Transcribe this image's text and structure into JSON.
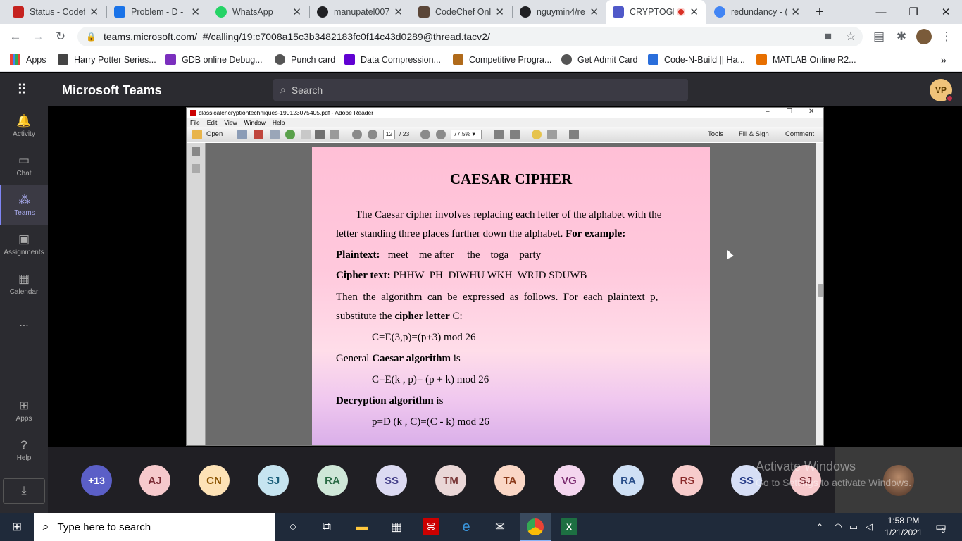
{
  "browser": {
    "tabs": [
      {
        "title": "Status - Codef",
        "color": "#c5221f"
      },
      {
        "title": "Problem - D -",
        "color": "#1a73e8"
      },
      {
        "title": "WhatsApp",
        "color": "#25d366"
      },
      {
        "title": "manupatel007",
        "color": "#202124"
      },
      {
        "title": "CodeChef Onli",
        "color": "#5b4638"
      },
      {
        "title": "nguymin4/reac",
        "color": "#202124"
      },
      {
        "title": "CRYPTOGI",
        "color": "#5059c9"
      },
      {
        "title": "redundancy - (",
        "color": "#4285f4"
      }
    ],
    "url": "teams.microsoft.com/_#/calling/19:c7008a15c3b3482183fc0f14c43d0289@thread.tacv2/",
    "bookmarks": [
      {
        "label": "Apps",
        "color": "#4285f4"
      },
      {
        "label": "Harry Potter Series...",
        "color": "#444"
      },
      {
        "label": "GDB online Debug...",
        "color": "#7b2fbe"
      },
      {
        "label": "Punch card",
        "color": "#555"
      },
      {
        "label": "Data Compression...",
        "color": "#6001d2"
      },
      {
        "label": "Competitive Progra...",
        "color": "#b06a1a"
      },
      {
        "label": "Get Admit Card",
        "color": "#555"
      },
      {
        "label": "Code-N-Build || Ha...",
        "color": "#2a6edb"
      },
      {
        "label": "MATLAB Online R2...",
        "color": "#e76f00"
      }
    ]
  },
  "teams": {
    "app_name": "Microsoft Teams",
    "search_placeholder": "Search",
    "user_initials": "VP",
    "rail": [
      {
        "label": "Activity",
        "icon": "bell-icon"
      },
      {
        "label": "Chat",
        "icon": "chat-icon"
      },
      {
        "label": "Teams",
        "icon": "teams-icon"
      },
      {
        "label": "Assignments",
        "icon": "assignments-icon"
      },
      {
        "label": "Calendar",
        "icon": "calendar-icon"
      },
      {
        "label": "...",
        "icon": "more-icon"
      },
      {
        "label": "Apps",
        "icon": "apps-icon"
      },
      {
        "label": "Help",
        "icon": "help-icon"
      }
    ],
    "participants": [
      "+13",
      "AJ",
      "CN",
      "SJ",
      "RA",
      "SS",
      "TM",
      "TA",
      "VG",
      "RA",
      "RS",
      "SS",
      "SJ"
    ],
    "activate_title": "Activate Windows",
    "activate_sub": "Go to Settings to activate Windows."
  },
  "reader": {
    "title": "classicalencryptiontechniques-190123075405.pdf - Adobe Reader",
    "menu": [
      "File",
      "Edit",
      "View",
      "Window",
      "Help"
    ],
    "open_label": "Open",
    "page_current": "12",
    "page_total": "/ 23",
    "zoom": "77.5%",
    "tools_label": "Tools",
    "fill_sign_label": "Fill & Sign",
    "comment_label": "Comment"
  },
  "doc": {
    "heading": "CAESAR CIPHER",
    "p1a": "The Caesar cipher involves replacing each letter of the alphabet with the",
    "p1b": "letter standing three places further down the alphabet.",
    "p1b_bold": "For example:",
    "plaintext_label": "Plaintext:",
    "plaintext_value": "meet    me after     the    toga    party",
    "cipher_label": "Cipher text:",
    "cipher_value": "PHHW  PH  DIWHU WKH  WRJD SDUWB",
    "p2a": "Then  the  algorithm  can  be  expressed  as  follows.  For  each  plaintext  p,",
    "p2b": "substitute the",
    "p2b_bold": "cipher letter",
    "p2b_end": "C:",
    "f1": "C=E(3,p)=(p+3) mod 26",
    "gen_a": "General",
    "gen_bold": "Caesar algorithm",
    "gen_end": "is",
    "f2": "C=E(k , p)= (p + k) mod 26",
    "dec_bold": "Decryption algorithm",
    "dec_end": "is",
    "f3": "p=D (k , C)=(C - k) mod 26"
  },
  "taskbar": {
    "search_placeholder": "Type here to search",
    "time": "1:58 PM",
    "date": "1/21/2021",
    "notif_count": "3"
  }
}
